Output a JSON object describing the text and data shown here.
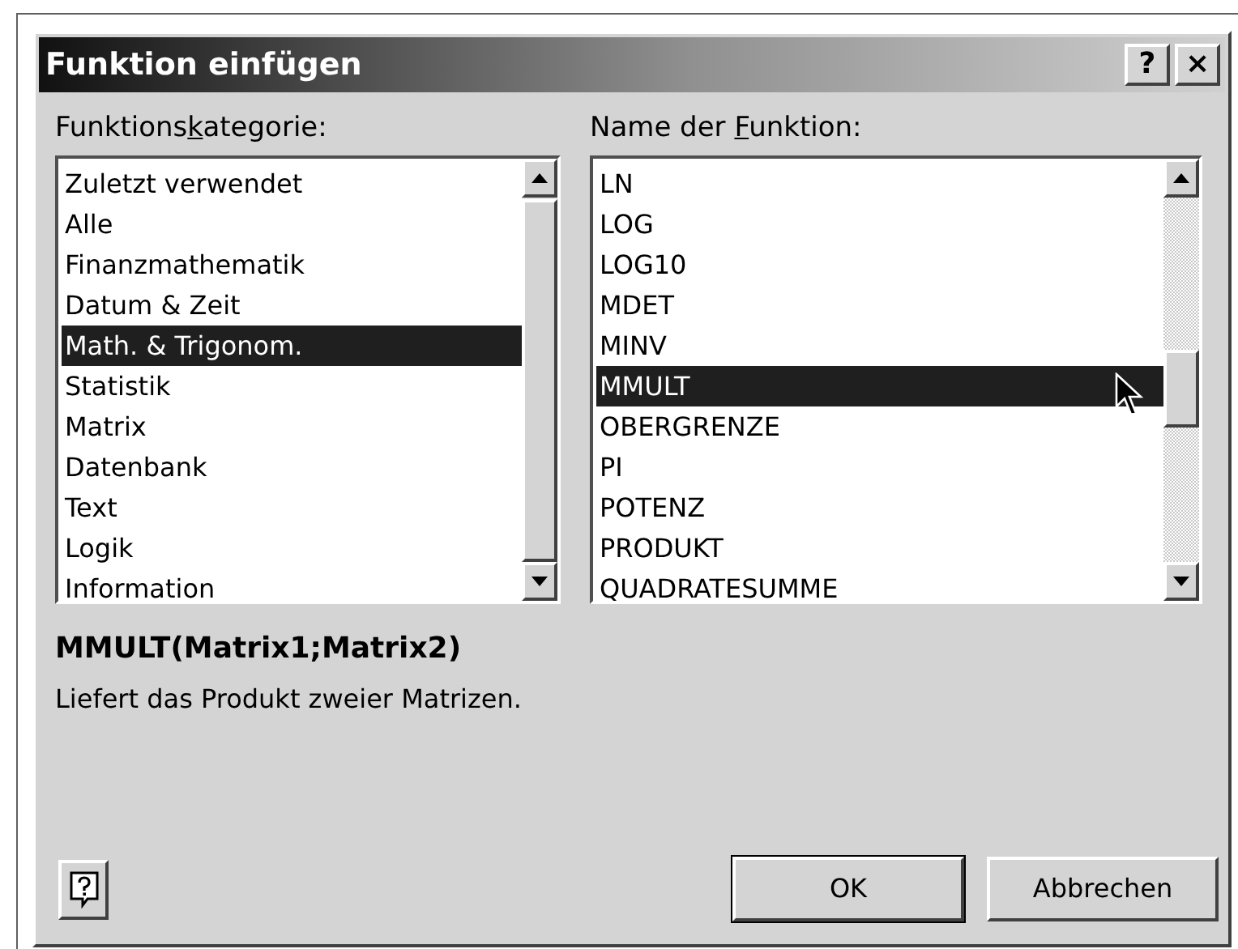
{
  "window": {
    "title": "Funktion einfügen",
    "buttons": [
      "?",
      "×"
    ]
  },
  "category_list": {
    "label": {
      "before": "Funktions",
      "mnemonic": "k",
      "after": "ategorie:"
    },
    "items": [
      {
        "label": "Zuletzt verwendet",
        "selected": false
      },
      {
        "label": "Alle",
        "selected": false
      },
      {
        "label": "Finanzmathematik",
        "selected": false
      },
      {
        "label": "Datum & Zeit",
        "selected": false
      },
      {
        "label": "Math. & Trigonom.",
        "selected": true
      },
      {
        "label": "Statistik",
        "selected": false
      },
      {
        "label": "Matrix",
        "selected": false
      },
      {
        "label": "Datenbank",
        "selected": false
      },
      {
        "label": "Text",
        "selected": false
      },
      {
        "label": "Logik",
        "selected": false
      },
      {
        "label": "Information",
        "selected": false
      }
    ]
  },
  "function_list": {
    "label": {
      "before": "Name der ",
      "mnemonic": "F",
      "after": "unktion:"
    },
    "items": [
      {
        "label": "LN",
        "selected": false
      },
      {
        "label": "LOG",
        "selected": false
      },
      {
        "label": "LOG10",
        "selected": false
      },
      {
        "label": "MDET",
        "selected": false
      },
      {
        "label": "MINV",
        "selected": false
      },
      {
        "label": "MMULT",
        "selected": true
      },
      {
        "label": "OBERGRENZE",
        "selected": false
      },
      {
        "label": "PI",
        "selected": false
      },
      {
        "label": "POTENZ",
        "selected": false
      },
      {
        "label": "PRODUKT",
        "selected": false
      },
      {
        "label": "QUADRATESUMME",
        "selected": false
      }
    ]
  },
  "syntax": "MMULT(Matrix1;Matrix2)",
  "description": "Liefert das Produkt zweier Matrizen.",
  "buttons": [
    {
      "label": "OK",
      "kind": "default"
    },
    {
      "label": "Abbrechen",
      "kind": "normal"
    }
  ]
}
